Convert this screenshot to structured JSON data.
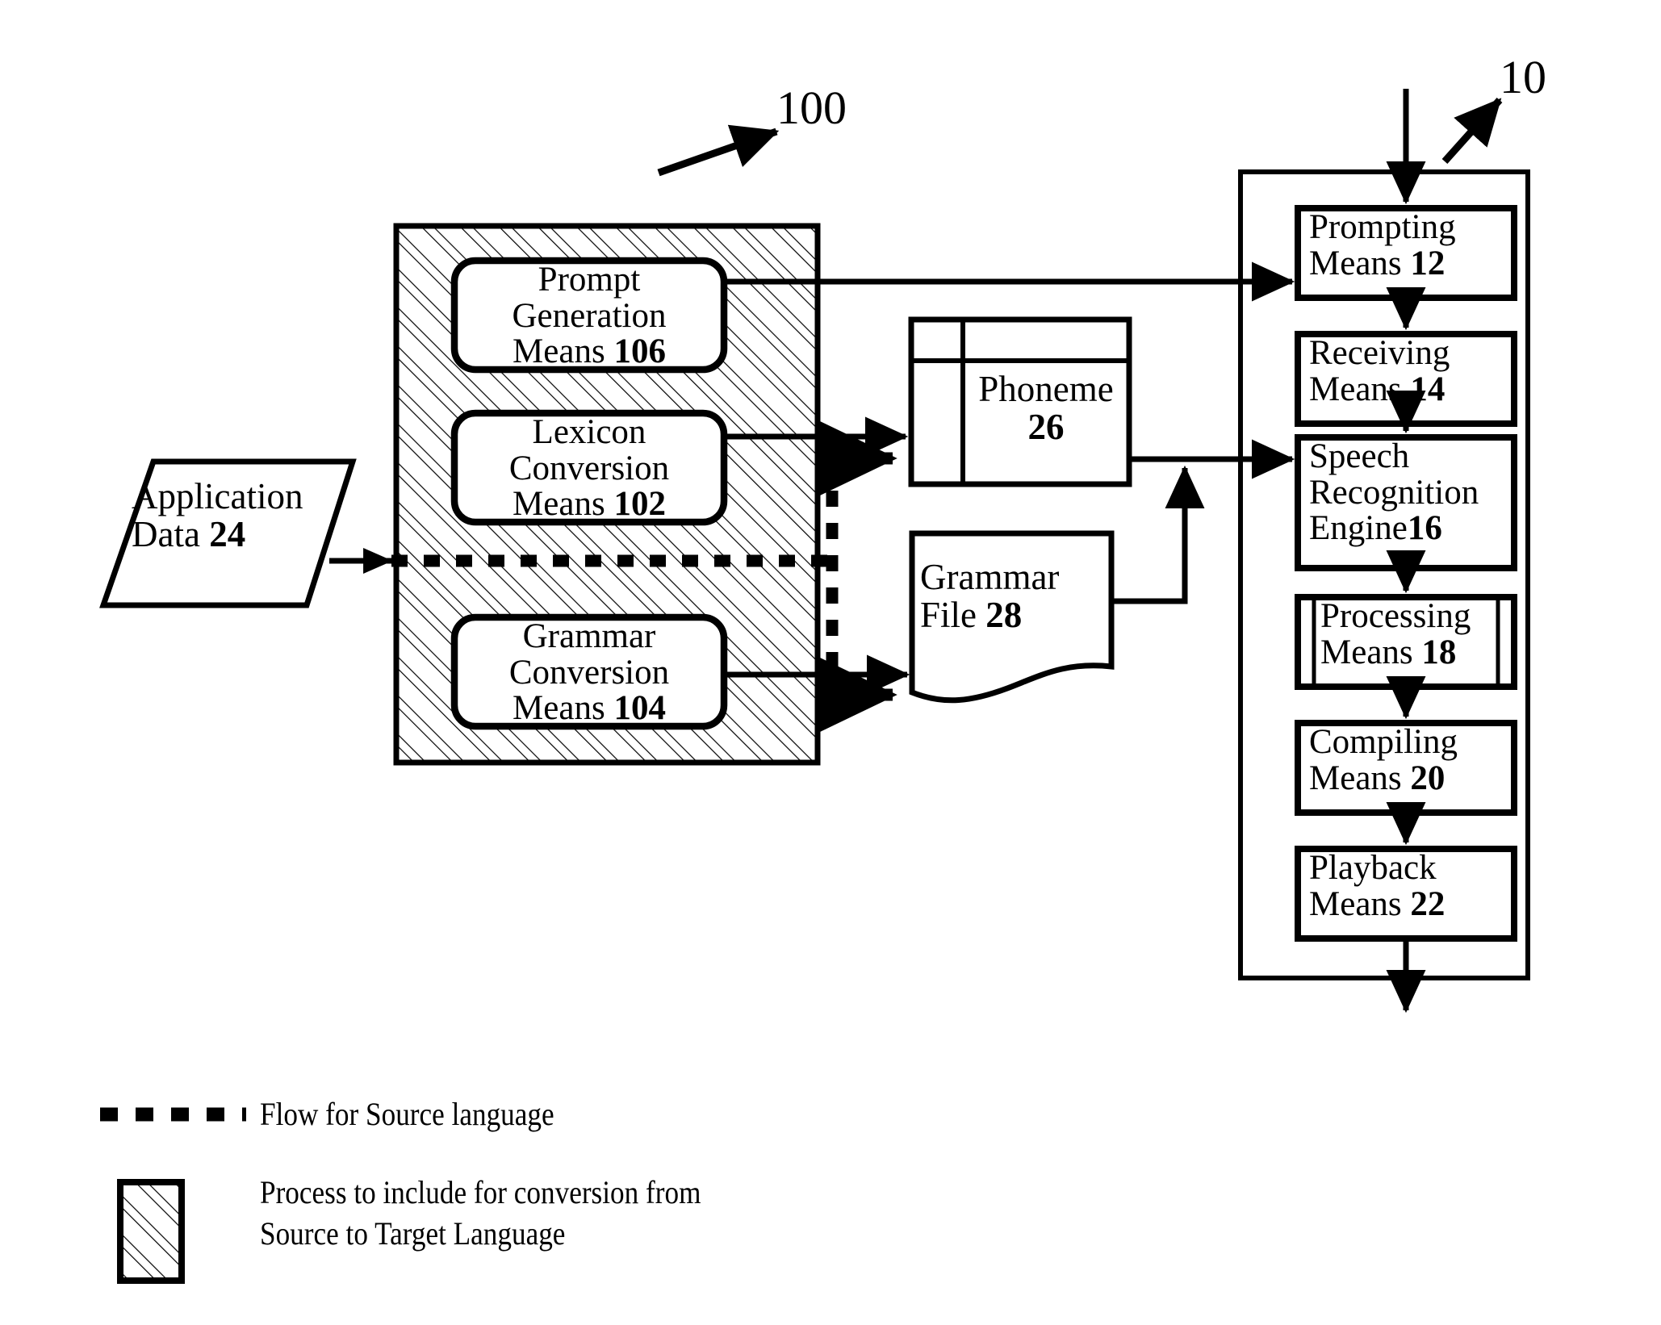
{
  "figure": {
    "callouts": [
      {
        "name": "outer-conversion-module",
        "ref": "100"
      },
      {
        "name": "speech-system",
        "ref": "10"
      }
    ]
  },
  "conversion_module": {
    "ref": "100",
    "boxes": [
      {
        "id": "prompt-generation",
        "line1": "Prompt",
        "line2": "Generation",
        "line3": "Means",
        "ref": "106"
      },
      {
        "id": "lexicon-conversion",
        "line1": "Lexicon",
        "line2": "Conversion",
        "line3": "Means",
        "ref": "102"
      },
      {
        "id": "grammar-conversion",
        "line1": "Grammar",
        "line2": "Conversion",
        "line3": "Means",
        "ref": "104"
      }
    ]
  },
  "input": {
    "id": "application-data",
    "line1": "Application",
    "line2": "Data",
    "ref": "24"
  },
  "artifacts": [
    {
      "id": "phoneme",
      "label": "Phoneme",
      "ref": "26",
      "shape": "table"
    },
    {
      "id": "grammar-file",
      "line1": "Grammar",
      "line2": "File",
      "ref": "28",
      "shape": "document"
    }
  ],
  "speech_system": {
    "ref": "10",
    "boxes": [
      {
        "id": "prompting-means",
        "line1": "Prompting",
        "line2": "Means",
        "ref": "12",
        "shape": "process"
      },
      {
        "id": "receiving-means",
        "line1": "Receiving",
        "line2": "Means",
        "ref": "14",
        "shape": "process"
      },
      {
        "id": "speech-recognition-engine",
        "line1": "Speech",
        "line2": "Recognition",
        "line3": "Engine",
        "ref": "16",
        "shape": "process"
      },
      {
        "id": "processing-means",
        "line1": "Processing",
        "line2": "Means",
        "ref": "18",
        "shape": "predefined-process"
      },
      {
        "id": "compiling-means",
        "line1": "Compiling",
        "line2": "Means",
        "ref": "20",
        "shape": "process"
      },
      {
        "id": "playback-means",
        "line1": "Playback",
        "line2": "Means",
        "ref": "22",
        "shape": "process"
      }
    ]
  },
  "legend": {
    "items": [
      {
        "id": "dashed-flow",
        "swatch": "dashed-line",
        "text": "Flow for Source language"
      },
      {
        "id": "hatched-process",
        "swatch": "hatched-square",
        "text": "Process to include for conversion from\nSource to Target Language"
      }
    ]
  },
  "colors": {
    "ink": "#000000",
    "paper": "#ffffff"
  }
}
